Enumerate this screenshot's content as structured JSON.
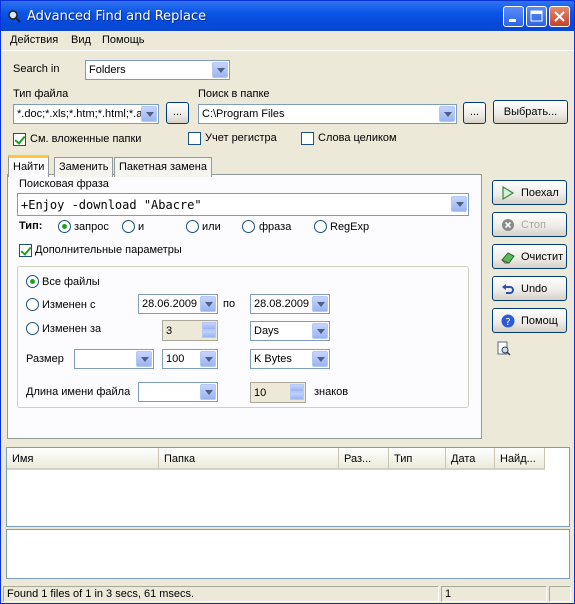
{
  "window": {
    "title": "Advanced Find and Replace"
  },
  "menu": [
    "Действия",
    "Вид",
    "Помощь"
  ],
  "search_in": {
    "label": "Search in",
    "value": "Folders"
  },
  "file_type": {
    "label": "Тип файла",
    "value": "*.doc;*.xls;*.htm;*.html;*.a"
  },
  "search_folder": {
    "label": "Поиск в папке",
    "value": "C:\\Program Files"
  },
  "browse_btn": "...",
  "select_btn": "Выбрать...",
  "options": {
    "subfolders": "См. вложенные папки",
    "case": "Учет регистра",
    "whole_words": "Слова целиком"
  },
  "tabs": [
    "Найти",
    "Заменить",
    "Пакетная замена"
  ],
  "phrase": {
    "label": "Поисковая фраза",
    "value": "+Enjoy -download \"Abacre\""
  },
  "type": {
    "label": "Тип:",
    "options": [
      "запрос",
      "и",
      "или",
      "фраза",
      "RegExp"
    ]
  },
  "advanced": {
    "label": "Дополнительные параметры"
  },
  "filters": {
    "all_files": "Все файлы",
    "changed_from": "Изменен с",
    "date_from": "28.06.2009",
    "to": "по",
    "date_to": "28.08.2009",
    "changed_within": "Изменен за",
    "within_value": "3",
    "within_unit": "Days",
    "size_label": "Размер",
    "size_op": "",
    "size_value": "100",
    "size_unit": "K Bytes",
    "name_len_label": "Длина имени файла",
    "name_len_op": "",
    "name_len_value": "10",
    "name_len_unit": "знаков"
  },
  "side_buttons": [
    "Поехал",
    "Стоп",
    "Очистит",
    "Undo",
    "Помощ"
  ],
  "columns": [
    "Имя",
    "Папка",
    "Раз...",
    "Тип",
    "Дата",
    "Найд..."
  ],
  "status": {
    "text": "Found 1 files of 1 in 3 secs, 61 msecs.",
    "count": "1"
  },
  "colors": {
    "title_bar": "#0a55e6",
    "accent_check": "#21a121"
  }
}
